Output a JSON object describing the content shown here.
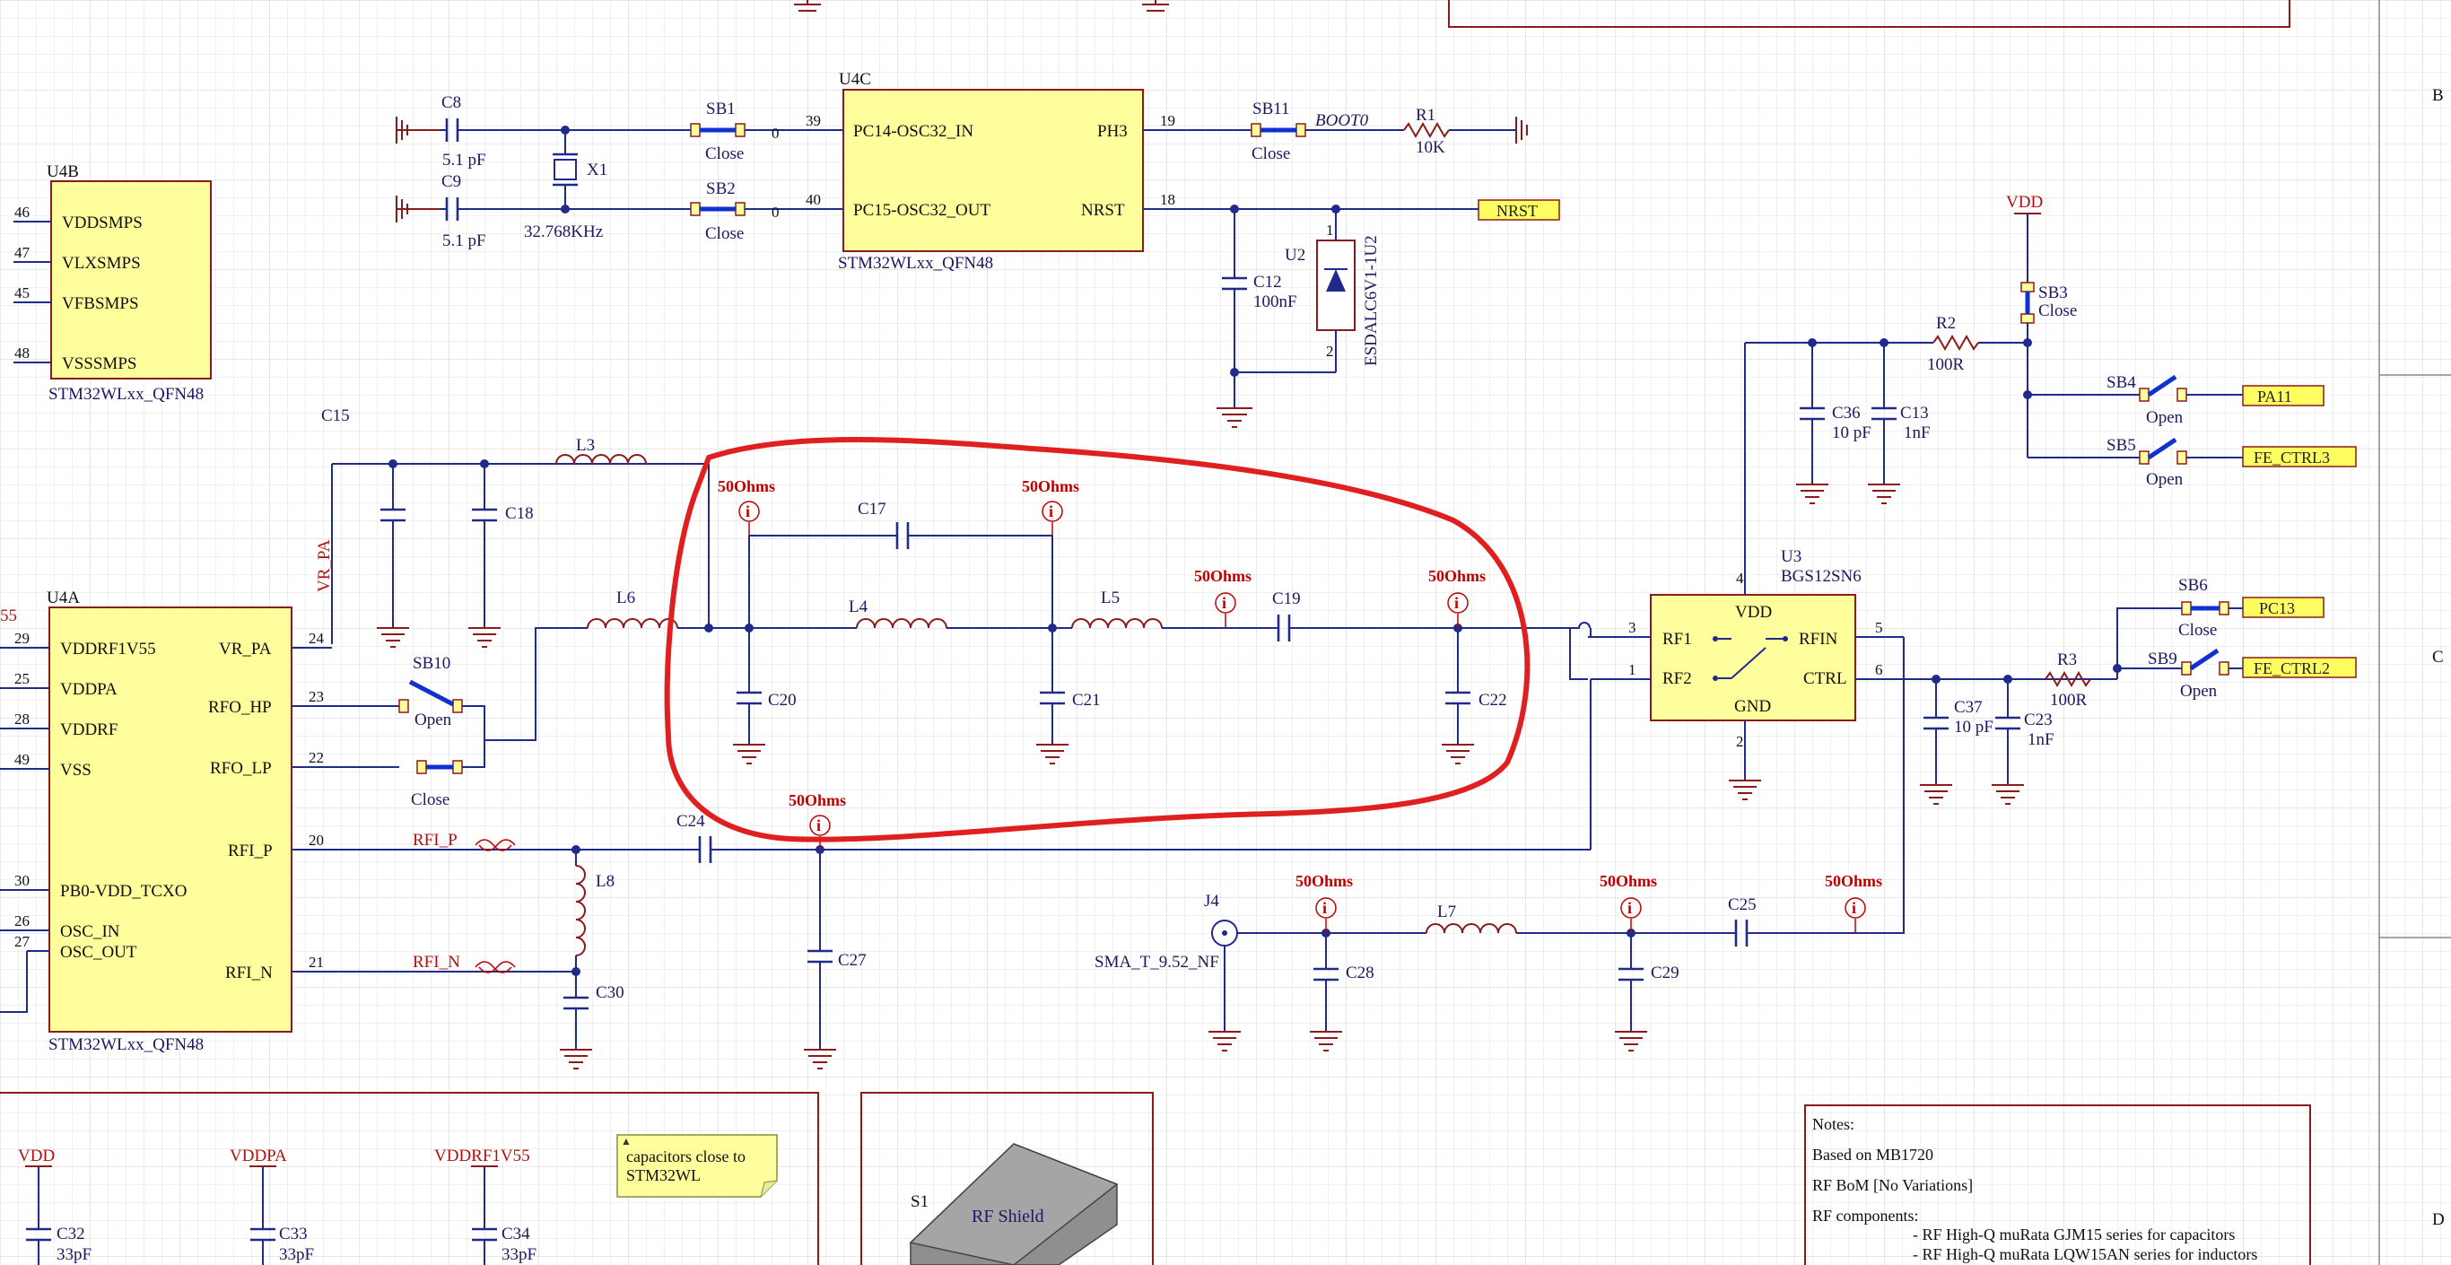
{
  "blocks": {
    "u4b": {
      "ref": "U4B",
      "part": "STM32WLxx_QFN48",
      "pins": [
        {
          "num": "46",
          "name": "VDDSMPS"
        },
        {
          "num": "47",
          "name": "VLXSMPS"
        },
        {
          "num": "45",
          "name": "VFBSMPS"
        },
        {
          "num": "48",
          "name": "VSSSMPS"
        }
      ]
    },
    "u4c": {
      "ref": "U4C",
      "part": "STM32WLxx_QFN48",
      "pins_left": [
        {
          "num": "39",
          "name": "PC14-OSC32_IN"
        },
        {
          "num": "40",
          "name": "PC15-OSC32_OUT"
        }
      ],
      "pins_right": [
        {
          "num": "19",
          "name": "PH3"
        },
        {
          "num": "18",
          "name": "NRST"
        }
      ]
    },
    "u4a": {
      "ref": "U4A",
      "part": "STM32WLxx_QFN48",
      "pins_left": [
        {
          "num": "29",
          "name": "VDDRF1V55"
        },
        {
          "num": "25",
          "name": "VDDPA"
        },
        {
          "num": "28",
          "name": "VDDRF"
        },
        {
          "num": "49",
          "name": "VSS"
        },
        {
          "num": "30",
          "name": "PB0-VDD_TCXO"
        },
        {
          "num": "26",
          "name": "OSC_IN"
        },
        {
          "num": "27",
          "name": "OSC_OUT"
        }
      ],
      "pins_right": [
        {
          "num": "24",
          "name": "VR_PA"
        },
        {
          "num": "23",
          "name": "RFO_HP"
        },
        {
          "num": "22",
          "name": "RFO_LP"
        },
        {
          "num": "20",
          "name": "RFI_P"
        },
        {
          "num": "21",
          "name": "RFI_N"
        }
      ],
      "edge_label": "55"
    },
    "u3": {
      "ref": "U3",
      "part": "BGS12SN6",
      "pins": {
        "vdd": "VDD",
        "rf1": "RF1",
        "rf2": "RF2",
        "rfin": "RFIN",
        "ctrl": "CTRL",
        "gnd": "GND"
      },
      "nums": {
        "p4": "4",
        "p3": "3",
        "p1": "1",
        "p5": "5",
        "p6": "6",
        "p2": "2"
      }
    }
  },
  "components": {
    "c8": {
      "ref": "C8",
      "value": "5.1 pF"
    },
    "c9": {
      "ref": "C9",
      "value": "5.1 pF"
    },
    "x1": {
      "ref": "X1",
      "value": "32.768KHz"
    },
    "sb1": {
      "ref": "SB1",
      "state": "Close",
      "pin": "0"
    },
    "sb2": {
      "ref": "SB2",
      "state": "Close",
      "pin": "0"
    },
    "sb11": {
      "ref": "SB11",
      "state": "Close"
    },
    "boot0": "BOOT0",
    "r1": {
      "ref": "R1",
      "value": "10K"
    },
    "c12": {
      "ref": "C12",
      "value": "100nF"
    },
    "u2": {
      "ref": "U2",
      "part": "ESDALC6V1-1U2",
      "p1": "1",
      "p2": "2"
    },
    "c15": {
      "ref": "C15"
    },
    "vrpa": "VR_PA",
    "l3": {
      "ref": "L3"
    },
    "c18": {
      "ref": "C18"
    },
    "c17": {
      "ref": "C17"
    },
    "l6": {
      "ref": "L6"
    },
    "l4": {
      "ref": "L4"
    },
    "l5": {
      "ref": "L5"
    },
    "c19": {
      "ref": "C19"
    },
    "c20": {
      "ref": "C20"
    },
    "c21": {
      "ref": "C21"
    },
    "c22": {
      "ref": "C22"
    },
    "sb10": {
      "ref": "SB10",
      "state": "Open"
    },
    "sbclose": {
      "state": "Close"
    },
    "c24": {
      "ref": "C24"
    },
    "l8": {
      "ref": "L8"
    },
    "c27": {
      "ref": "C27"
    },
    "c30": {
      "ref": "C30"
    },
    "rfip": "RFI_P",
    "rfin": "RFI_N",
    "j4": {
      "ref": "J4",
      "part": "SMA_T_9.52_NF"
    },
    "c28": {
      "ref": "C28"
    },
    "l7": {
      "ref": "L7"
    },
    "c29": {
      "ref": "C29"
    },
    "c25": {
      "ref": "C25"
    },
    "c36": {
      "ref": "C36",
      "value": "10 pF"
    },
    "c13": {
      "ref": "C13",
      "value": "1nF"
    },
    "r2": {
      "ref": "R2",
      "value": "100R"
    },
    "sb3": {
      "ref": "SB3",
      "state": "Close"
    },
    "sb4": {
      "ref": "SB4",
      "state": "Open"
    },
    "sb5": {
      "ref": "SB5",
      "state": "Open"
    },
    "sb6": {
      "ref": "SB6",
      "state": "Close"
    },
    "sb9": {
      "ref": "SB9",
      "state": "Open"
    },
    "r3": {
      "ref": "R3",
      "value": "100R"
    },
    "c37": {
      "ref": "C37",
      "value": "10 pF"
    },
    "c23": {
      "ref": "C23",
      "value": "1nF"
    },
    "c32": {
      "ref": "C32",
      "value": "33pF"
    },
    "c33": {
      "ref": "C33",
      "value": "33pF"
    },
    "c34": {
      "ref": "C34",
      "value": "33pF"
    },
    "s1": {
      "ref": "S1",
      "part": "RF Shield"
    }
  },
  "impedance_label": "50Ohms",
  "nets": {
    "nrst": "NRST",
    "pa11": "PA11",
    "fe_ctrl3": "FE_CTRL3",
    "pc13": "PC13",
    "fe_ctrl2": "FE_CTRL2",
    "vdd": "VDD",
    "vddpa": "VDDPA",
    "vddrf1v55": "VDDRF1V55"
  },
  "note_box": {
    "text1": "capacitors close to",
    "text2": "STM32WL"
  },
  "notes": {
    "title": "Notes:",
    "line1": "Based on MB1720",
    "line2": "RF BoM [No Variations]",
    "line3": "RF components:",
    "line4": "- RF High-Q muRata GJM15 series for capacitors",
    "line5": "- RF High-Q muRata LQW15AN series for inductors"
  },
  "zones": {
    "b": "B",
    "c": "C",
    "d": "D"
  }
}
